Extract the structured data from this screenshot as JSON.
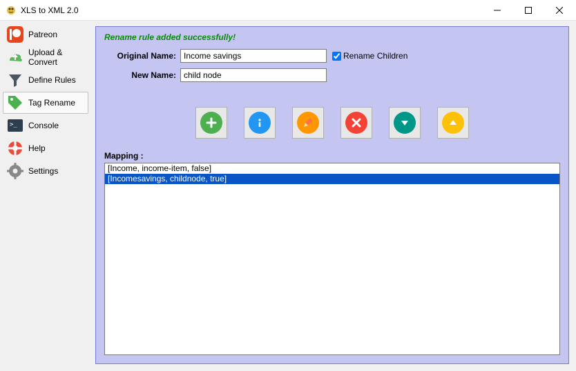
{
  "window": {
    "title": "XLS to XML 2.0"
  },
  "sidebar": {
    "items": [
      {
        "label": "Patreon"
      },
      {
        "label": "Upload & Convert"
      },
      {
        "label": "Define Rules"
      },
      {
        "label": "Tag Rename"
      },
      {
        "label": "Console"
      },
      {
        "label": "Help"
      },
      {
        "label": "Settings"
      }
    ]
  },
  "panel": {
    "status_message": "Rename rule added successfully!",
    "original_name_label": "Original Name:",
    "original_name_value": "Income savings",
    "rename_children_label": "Rename Children",
    "rename_children_checked": true,
    "new_name_label": "New Name:",
    "new_name_value": "child node",
    "mapping_label": "Mapping :",
    "mapping_rows": [
      "[Income, income-item, false]",
      "[Incomesavings, childnode, true]"
    ],
    "selected_row_index": 1
  }
}
